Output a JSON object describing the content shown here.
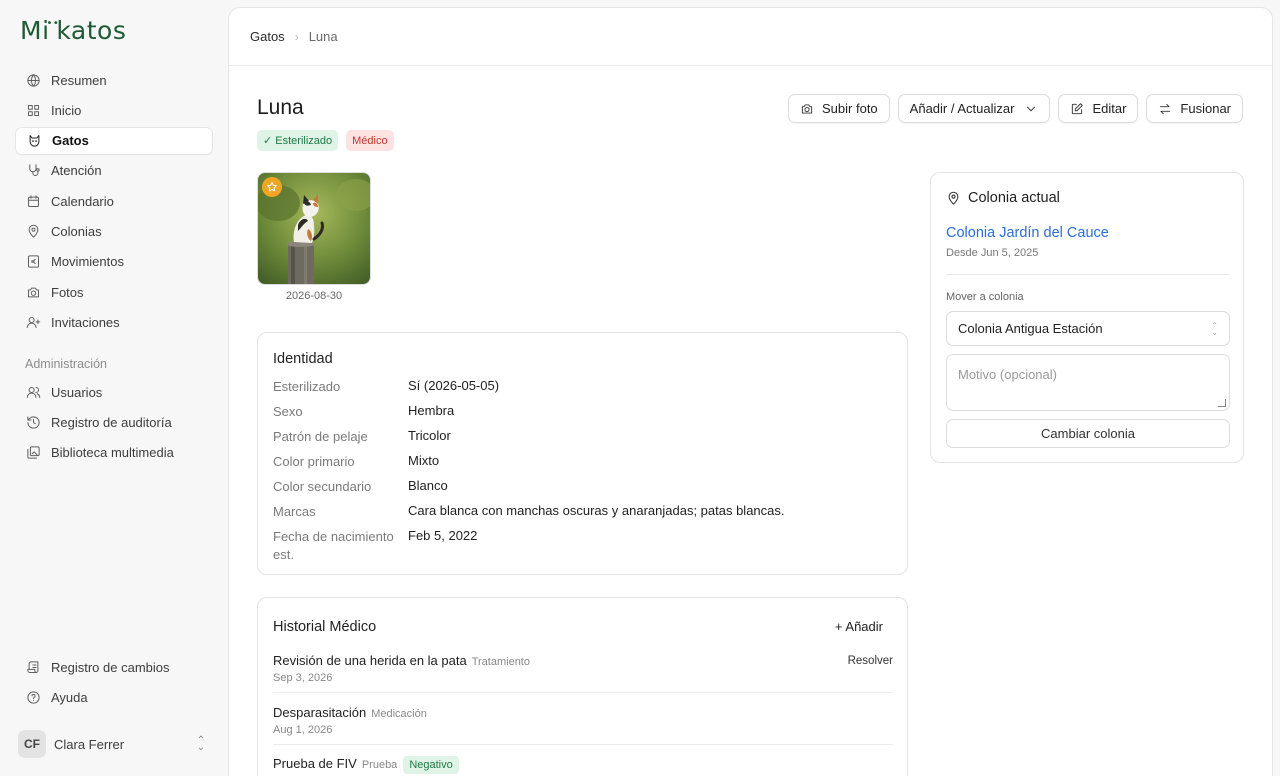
{
  "app": {
    "logo": "Mikatos"
  },
  "sidebar": {
    "items": [
      {
        "label": "Resumen",
        "icon": "globe-icon"
      },
      {
        "label": "Inicio",
        "icon": "grid-icon"
      },
      {
        "label": "Gatos",
        "icon": "cat-icon",
        "active": true
      },
      {
        "label": "Atención",
        "icon": "stethoscope-icon"
      },
      {
        "label": "Calendario",
        "icon": "calendar-icon"
      },
      {
        "label": "Colonias",
        "icon": "map-pin-icon"
      },
      {
        "label": "Movimientos",
        "icon": "euro-icon"
      },
      {
        "label": "Fotos",
        "icon": "camera-icon"
      },
      {
        "label": "Invitaciones",
        "icon": "user-plus-icon"
      }
    ],
    "admin_label": "Administración",
    "admin_items": [
      {
        "label": "Usuarios",
        "icon": "users-icon"
      },
      {
        "label": "Registro de auditoría",
        "icon": "history-icon"
      },
      {
        "label": "Biblioteca multimedia",
        "icon": "images-icon"
      }
    ],
    "footer_items": [
      {
        "label": "Registro de cambios",
        "icon": "scroll-icon"
      },
      {
        "label": "Ayuda",
        "icon": "help-icon"
      }
    ],
    "user": {
      "initials": "CF",
      "name": "Clara Ferrer"
    }
  },
  "breadcrumb": {
    "parent": "Gatos",
    "current": "Luna"
  },
  "cat": {
    "name": "Luna",
    "badges": {
      "sterilized": "✓ Esterilizado",
      "medical": "Médico"
    },
    "photo_date": "2026-08-30"
  },
  "actions": {
    "upload": "Subir foto",
    "add_update": "Añadir / Actualizar",
    "edit": "Editar",
    "merge": "Fusionar"
  },
  "identity": {
    "title": "Identidad",
    "rows": [
      {
        "k": "Esterilizado",
        "v": "Sí (2026-05-05)"
      },
      {
        "k": "Sexo",
        "v": "Hembra"
      },
      {
        "k": "Patrón de pelaje",
        "v": "Tricolor"
      },
      {
        "k": "Color primario",
        "v": "Mixto"
      },
      {
        "k": "Color secundario",
        "v": "Blanco"
      },
      {
        "k": "Marcas",
        "v": "Cara blanca con manchas oscuras y anaranjadas; patas blancas."
      },
      {
        "k": "Fecha de nacimiento est.",
        "v": "Feb 5, 2022"
      }
    ]
  },
  "medical": {
    "title": "Historial Médico",
    "add": "+ Añadir",
    "entries": [
      {
        "title": "Revisión de una herida en la pata",
        "category": "Tratamiento",
        "date": "Sep 3, 2026",
        "action": "Resolver"
      },
      {
        "title": "Desparasitación",
        "category": "Medicación",
        "date": "Aug 1, 2026"
      },
      {
        "title": "Prueba de FIV",
        "category": "Prueba",
        "result": "Negativo"
      }
    ]
  },
  "colony": {
    "title": "Colonia actual",
    "name": "Colonia Jardín del Cauce",
    "since": "Desde Jun 5, 2025",
    "move_label": "Mover a colonia",
    "selected": "Colonia Antigua Estación",
    "reason_placeholder": "Motivo (opcional)",
    "change_button": "Cambiar colonia"
  },
  "colors": {
    "accent_link": "#2b6fd6",
    "brand": "#1e5a34",
    "star": "#f0a525",
    "success_bg": "#dff4e6",
    "danger_bg": "#fde2e2"
  }
}
